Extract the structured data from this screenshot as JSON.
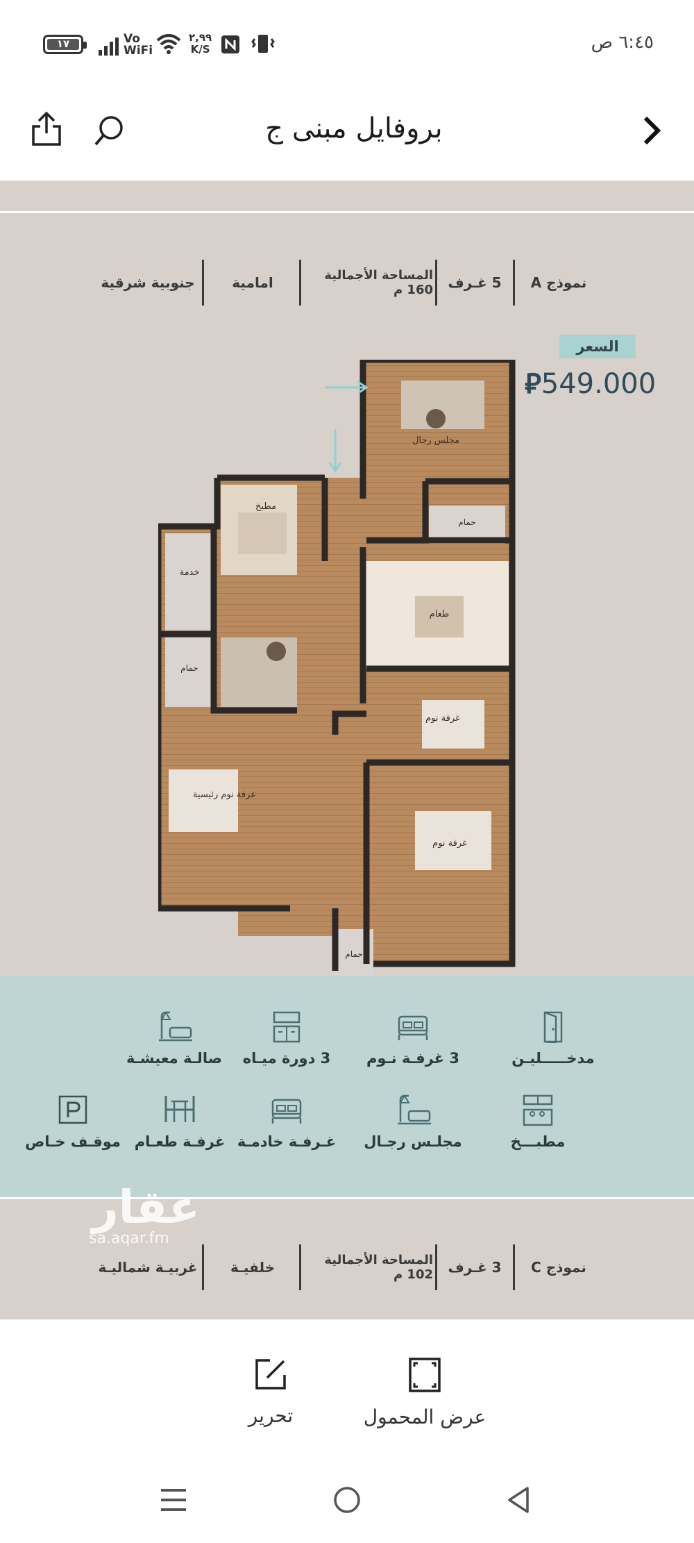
{
  "status_bar": {
    "battery": "١٧",
    "network": "Vo\nWiFi",
    "net_speed_value": "٢,٩٩",
    "net_speed_unit": "K/S",
    "time": "٦:٤٥ ص"
  },
  "header": {
    "title": "بروفايل مبنى ج",
    "icons": [
      "share-icon",
      "search-icon",
      "chevron-right-icon"
    ]
  },
  "plan_a": {
    "model": "نموذج A",
    "rooms": "5 غـرف",
    "area": "المساحة الأجمالية 160 م",
    "facing": "امامية",
    "direction": "جنوبية شرقية"
  },
  "price": {
    "label": "السعر",
    "value": "549.000"
  },
  "floorplan_labels": {
    "majlis": "مجلس رجال",
    "kitchen": "مطبخ",
    "maid": "خدمة",
    "dining": "طعام",
    "bath1": "حمام",
    "bath2": "حمام",
    "bath3": "حمام",
    "bedroom1": "غرفة نوم",
    "bedroom2": "غرفة نوم",
    "master": "غرفة نوم رئيسية"
  },
  "features": [
    {
      "label": "مدخـــــليـن",
      "icon": "door-icon"
    },
    {
      "label": "3 غرفـة نـوم",
      "icon": "bed-icon"
    },
    {
      "label": "3 دورة ميـاه",
      "icon": "bathroom-icon"
    },
    {
      "label": "صالـة معيشـة",
      "icon": "living-room-icon"
    },
    {
      "label": "مطبـــخ",
      "icon": "kitchen-icon"
    },
    {
      "label": "مجلـس رجـال",
      "icon": "majlis-icon"
    },
    {
      "label": "غـرفـة خادمـة",
      "icon": "maid-room-icon"
    },
    {
      "label": "غرفـة طعـام",
      "icon": "dining-icon"
    },
    {
      "label": "موقـف خـاص",
      "icon": "parking-icon"
    }
  ],
  "watermark": {
    "logo": "عقار",
    "url": "sa.aqar.fm"
  },
  "plan_c": {
    "model": "نموذج C",
    "rooms": "3 غـرف",
    "area": "المساحة الأجمالية 102 م",
    "facing": "خلفيـة",
    "direction": "غربيـة شماليـة"
  },
  "actions": {
    "fullscreen": "عرض المحمول",
    "edit": "تحرير"
  },
  "colors": {
    "background": "#d8d1cb",
    "band": "#bed5d4",
    "price": "#2f4c5a",
    "price_label_bg": "#a9d3d0"
  }
}
